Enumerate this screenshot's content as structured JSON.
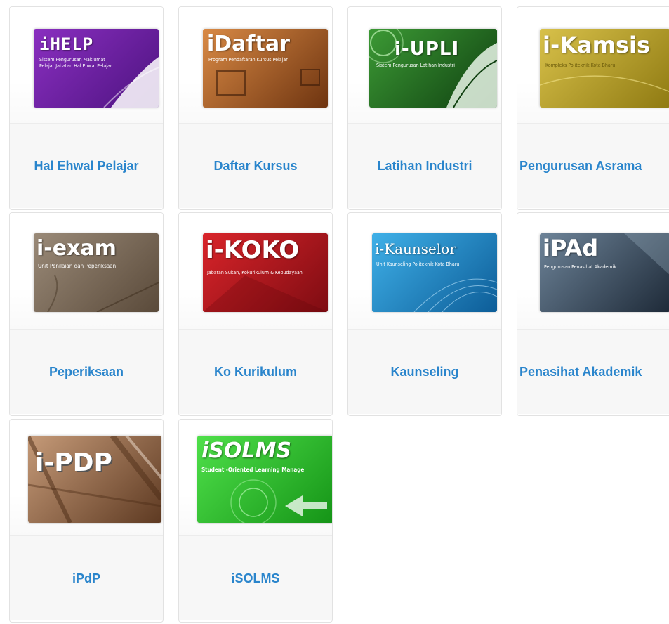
{
  "apps": [
    {
      "label": "Hal Ehwal Pelajar",
      "banner_title": "iHELP",
      "banner_subtitle": "Sistem Pengurusan Maklumat Pelajar Jabatan Hal Ehwal Pelajar",
      "colors": [
        "#8a2fc0",
        "#4d1380"
      ]
    },
    {
      "label": "Daftar Kursus",
      "banner_title": "iDaftar",
      "banner_subtitle": "Program Pendaftaran Kursus Pelajar",
      "colors": [
        "#d98a45",
        "#6e3410"
      ]
    },
    {
      "label": "Latihan Industri",
      "banner_title": "i-UPLI",
      "banner_subtitle": "Sistem Pengurusan Latihan Industri",
      "colors": [
        "#3c9a35",
        "#0f3f10"
      ]
    },
    {
      "label": "Pengurusan Asrama",
      "banner_title": "i-Kamsis",
      "banner_subtitle": "Kompleks Politeknik Kota Bharu",
      "colors": [
        "#d8c14a",
        "#8f7a12"
      ]
    },
    {
      "label": "Peperiksaan",
      "banner_title": "i-exam",
      "banner_subtitle": "Unit Penilaian dan Peperiksaan",
      "colors": [
        "#9a8a78",
        "#5a4a3a"
      ]
    },
    {
      "label": "Ko Kurikulum",
      "banner_title": "i-KOKO",
      "banner_subtitle": "Jabatan Sukan, Kokurikulum & Kebudayaan",
      "colors": [
        "#d9242a",
        "#7e0c12"
      ]
    },
    {
      "label": "Kaunseling",
      "banner_title": "i-Kaunselor",
      "banner_subtitle": "Unit Kaunseling Politeknik Kota Bharu",
      "colors": [
        "#3fb0e8",
        "#0d5d98"
      ]
    },
    {
      "label": "Penasihat Akademik",
      "banner_title": "iPAd",
      "banner_subtitle": "Pengurusan Penasihat Akademik",
      "colors": [
        "#6d8398",
        "#1e2a38"
      ]
    },
    {
      "label": "iPdP",
      "banner_title": "i-PDP",
      "banner_subtitle": "",
      "colors": [
        "#c59a78",
        "#5e3a22"
      ]
    },
    {
      "label": "iSOLMS",
      "banner_title": "iSOLMS",
      "banner_subtitle": "Student -Oriented Learning Manage",
      "colors": [
        "#4fe04a",
        "#159417"
      ]
    }
  ]
}
